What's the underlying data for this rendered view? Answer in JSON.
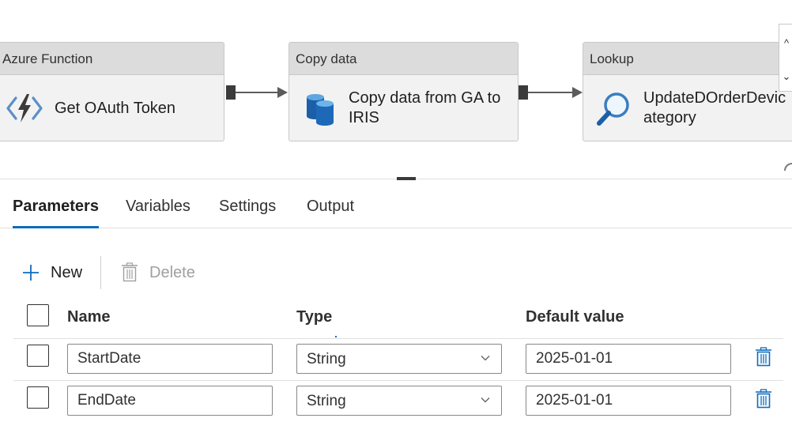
{
  "pipeline": {
    "activities": [
      {
        "type": "Azure Function",
        "name": "Get OAuth Token",
        "icon": "azure-function-icon"
      },
      {
        "type": "Copy data",
        "name": "Copy data from GA to\nIRIS",
        "icon": "database-icon"
      },
      {
        "type": "Lookup",
        "name": "UpdateDOrderDevic\nategory",
        "icon": "magnifier-icon"
      }
    ],
    "zoom_controls": {
      "up": "^",
      "down": "⌄"
    }
  },
  "tabs": [
    {
      "label": "Parameters",
      "active": true
    },
    {
      "label": "Variables",
      "active": false
    },
    {
      "label": "Settings",
      "active": false
    },
    {
      "label": "Output",
      "active": false
    }
  ],
  "toolbar": {
    "new_label": "New",
    "new_icon": "plus-icon",
    "delete_label": "Delete",
    "delete_icon": "trash-icon"
  },
  "grid": {
    "headers": {
      "name": "Name",
      "type": "Type",
      "default_value": "Default value"
    },
    "rows": [
      {
        "name": "StartDate",
        "type": "String",
        "default_value": "2025-01-01"
      },
      {
        "name": "EndDate",
        "type": "String",
        "default_value": "2025-01-01"
      }
    ]
  },
  "colors": {
    "accent": "#0f6cbd",
    "header_bg": "#dcdcdc",
    "activity_bg": "#f2f2f2",
    "disabled_text": "#a19f9d"
  }
}
